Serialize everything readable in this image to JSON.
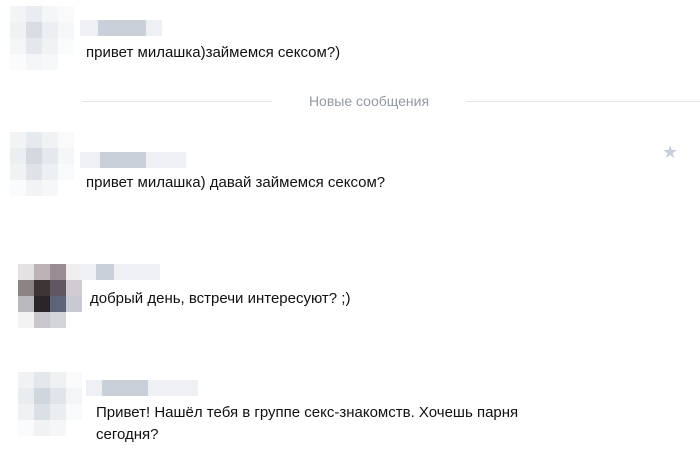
{
  "colors": {
    "text": "#111111",
    "divider_text": "#939aa3",
    "divider_line": "#e3e6ea",
    "star": "#c7d0da",
    "pixelated_name": "#c9d0da"
  },
  "messages": [
    {
      "sender_name_visible": false,
      "text": "привет милашка)займемся сексом?)"
    },
    {
      "sender_name_visible": false,
      "text": "привет милашка) давай займемся сексом?"
    },
    {
      "sender_name_visible": false,
      "text": "добрый день, встречи интересуют? ;)"
    },
    {
      "sender_name_visible": false,
      "text": "Привет! Нашёл тебя в группе секс-знакомств. Хочешь парня\nсегодня?"
    }
  ],
  "divider": {
    "label": "Новые сообщения"
  },
  "star_icon": "star-icon"
}
